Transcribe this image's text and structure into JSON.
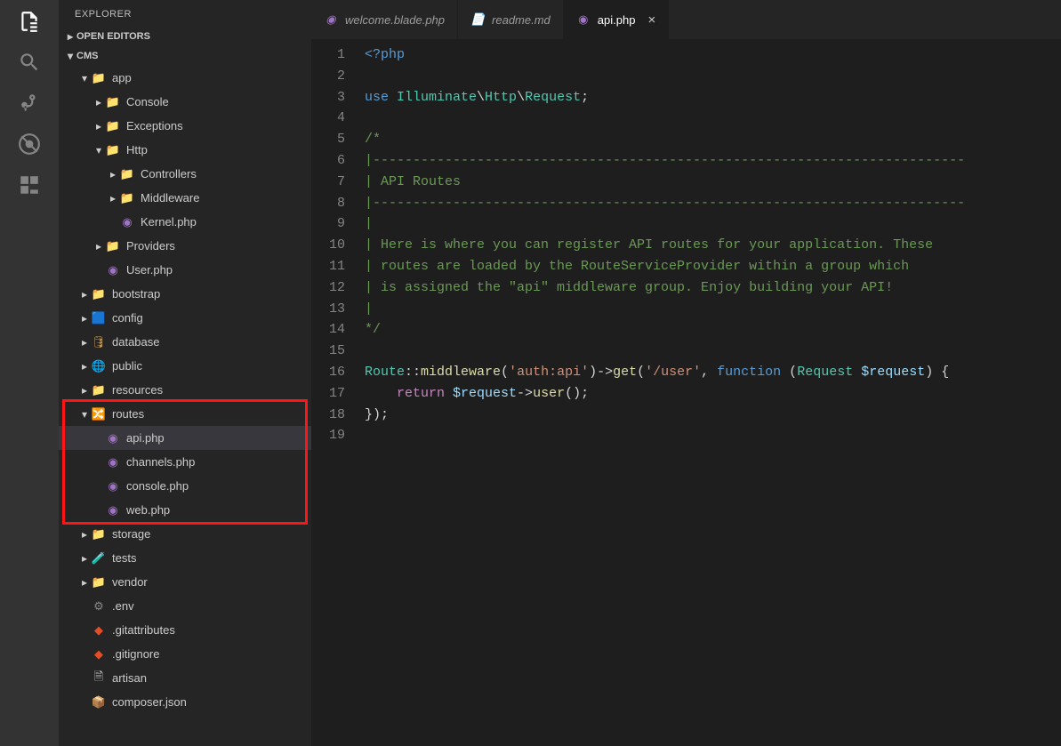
{
  "sidebar": {
    "title": "EXPLORER",
    "sections": {
      "open_editors": "OPEN EDITORS",
      "project": "CMS"
    }
  },
  "tree": [
    {
      "d": 1,
      "t": "folder-open",
      "n": "app",
      "ic": "📁",
      "exp": true,
      "twisty": "▾"
    },
    {
      "d": 2,
      "t": "folder-closed",
      "n": "Console",
      "ic": "📁",
      "twisty": "▸"
    },
    {
      "d": 2,
      "t": "folder-closed",
      "n": "Exceptions",
      "ic": "📁",
      "twisty": "▸"
    },
    {
      "d": 2,
      "t": "folder-open",
      "n": "Http",
      "ic": "📁",
      "exp": true,
      "twisty": "▾"
    },
    {
      "d": 3,
      "t": "folder-closed",
      "n": "Controllers",
      "ic": "📁",
      "twisty": "▸"
    },
    {
      "d": 3,
      "t": "folder-closed",
      "n": "Middleware",
      "ic": "📁",
      "twisty": "▸"
    },
    {
      "d": 3,
      "t": "php",
      "n": "Kernel.php",
      "ic": "◉"
    },
    {
      "d": 2,
      "t": "folder-closed",
      "n": "Providers",
      "ic": "📁",
      "twisty": "▸"
    },
    {
      "d": 2,
      "t": "php",
      "n": "User.php",
      "ic": "◉"
    },
    {
      "d": 1,
      "t": "folder-closed",
      "n": "bootstrap",
      "ic": "📁",
      "twisty": "▸"
    },
    {
      "d": 1,
      "t": "folder-closed",
      "n": "config",
      "ic": "🟦",
      "twisty": "▸"
    },
    {
      "d": 1,
      "t": "folder-closed",
      "n": "database",
      "ic": "🛢",
      "twisty": "▸"
    },
    {
      "d": 1,
      "t": "folder-closed",
      "n": "public",
      "ic": "🌐",
      "twisty": "▸"
    },
    {
      "d": 1,
      "t": "folder-closed",
      "n": "resources",
      "ic": "📁",
      "twisty": "▸"
    },
    {
      "d": 1,
      "t": "folder-open",
      "n": "routes",
      "ic": "🔀",
      "exp": true,
      "twisty": "▾",
      "hl": true
    },
    {
      "d": 2,
      "t": "php",
      "n": "api.php",
      "ic": "◉",
      "sel": true,
      "hl": true
    },
    {
      "d": 2,
      "t": "php",
      "n": "channels.php",
      "ic": "◉",
      "hl": true
    },
    {
      "d": 2,
      "t": "php",
      "n": "console.php",
      "ic": "◉",
      "hl": true
    },
    {
      "d": 2,
      "t": "php",
      "n": "web.php",
      "ic": "◉",
      "hl": true
    },
    {
      "d": 1,
      "t": "folder-closed",
      "n": "storage",
      "ic": "📁",
      "twisty": "▸"
    },
    {
      "d": 1,
      "t": "folder-closed",
      "n": "tests",
      "ic": "🧪",
      "twisty": "▸"
    },
    {
      "d": 1,
      "t": "folder-closed",
      "n": "vendor",
      "ic": "📁",
      "twisty": "▸"
    },
    {
      "d": 1,
      "t": "cfg",
      "n": ".env",
      "ic": "⚙"
    },
    {
      "d": 1,
      "t": "git",
      "n": ".gitattributes",
      "ic": "◆"
    },
    {
      "d": 1,
      "t": "git",
      "n": ".gitignore",
      "ic": "◆"
    },
    {
      "d": 1,
      "t": "file",
      "n": "artisan",
      "ic": "🗎"
    },
    {
      "d": 1,
      "t": "file",
      "n": "composer.json",
      "ic": "📦"
    }
  ],
  "tabs": [
    {
      "label": "welcome.blade.php",
      "icon": "◉",
      "iconClass": "php-ic",
      "active": false
    },
    {
      "label": "readme.md",
      "icon": "📄",
      "iconClass": "md-ic",
      "active": false
    },
    {
      "label": "api.php",
      "icon": "◉",
      "iconClass": "php-ic",
      "active": true,
      "close": "×"
    }
  ],
  "code": {
    "lines": [
      {
        "n": 1,
        "seg": [
          [
            "<?php",
            "k-blue"
          ]
        ]
      },
      {
        "n": 2,
        "seg": [
          [
            "",
            ""
          ]
        ]
      },
      {
        "n": 3,
        "seg": [
          [
            "use ",
            "k-blue"
          ],
          [
            "Illuminate",
            "k-type"
          ],
          [
            "\\",
            "k-white"
          ],
          [
            "Http",
            "k-type"
          ],
          [
            "\\",
            "k-white"
          ],
          [
            "Request",
            "k-type"
          ],
          [
            ";",
            "k-white"
          ]
        ]
      },
      {
        "n": 4,
        "seg": [
          [
            "",
            ""
          ]
        ]
      },
      {
        "n": 5,
        "seg": [
          [
            "/*",
            "k-cmt"
          ]
        ]
      },
      {
        "n": 6,
        "seg": [
          [
            "|--------------------------------------------------------------------------",
            "k-cmt"
          ]
        ]
      },
      {
        "n": 7,
        "seg": [
          [
            "| API Routes",
            "k-cmt"
          ]
        ]
      },
      {
        "n": 8,
        "seg": [
          [
            "|--------------------------------------------------------------------------",
            "k-cmt"
          ]
        ]
      },
      {
        "n": 9,
        "seg": [
          [
            "|",
            "k-cmt"
          ]
        ]
      },
      {
        "n": 10,
        "seg": [
          [
            "| Here is where you can register API routes for your application. These",
            "k-cmt"
          ]
        ]
      },
      {
        "n": 11,
        "seg": [
          [
            "| routes are loaded by the RouteServiceProvider within a group which",
            "k-cmt"
          ]
        ]
      },
      {
        "n": 12,
        "seg": [
          [
            "| is assigned the \"api\" middleware group. Enjoy building your API!",
            "k-cmt"
          ]
        ]
      },
      {
        "n": 13,
        "seg": [
          [
            "|",
            "k-cmt"
          ]
        ]
      },
      {
        "n": 14,
        "seg": [
          [
            "*/",
            "k-cmt"
          ]
        ]
      },
      {
        "n": 15,
        "seg": [
          [
            "",
            ""
          ]
        ]
      },
      {
        "n": 16,
        "seg": [
          [
            "Route",
            "k-type"
          ],
          [
            "::",
            "k-white"
          ],
          [
            "middleware",
            "k-fn"
          ],
          [
            "(",
            "k-white"
          ],
          [
            "'auth:api'",
            "k-str"
          ],
          [
            ")->",
            "k-white"
          ],
          [
            "get",
            "k-fn"
          ],
          [
            "(",
            "k-white"
          ],
          [
            "'/user'",
            "k-str"
          ],
          [
            ", ",
            "k-white"
          ],
          [
            "function ",
            "k-blue"
          ],
          [
            "(",
            "k-white"
          ],
          [
            "Request ",
            "k-type"
          ],
          [
            "$request",
            "k-var"
          ],
          [
            ") {",
            "k-white"
          ]
        ]
      },
      {
        "n": 17,
        "seg": [
          [
            "    ",
            ""
          ],
          [
            "return ",
            "k-pink"
          ],
          [
            "$request",
            "k-var"
          ],
          [
            "->",
            "k-white"
          ],
          [
            "user",
            "k-fn"
          ],
          [
            "();",
            "k-white"
          ]
        ]
      },
      {
        "n": 18,
        "seg": [
          [
            "});",
            "k-white"
          ]
        ]
      },
      {
        "n": 19,
        "seg": [
          [
            "",
            ""
          ]
        ]
      }
    ]
  }
}
